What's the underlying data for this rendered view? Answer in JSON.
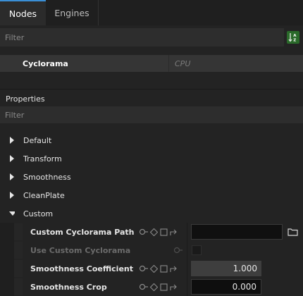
{
  "tabs": [
    {
      "label": "Nodes",
      "active": true
    },
    {
      "label": "Engines",
      "active": false
    }
  ],
  "nodes_filter": {
    "placeholder": "Filter",
    "sort_icon": "sort-alpha-icon"
  },
  "node_list": [
    {
      "name": "Cyclorama",
      "device": "CPU"
    }
  ],
  "properties": {
    "title": "Properties",
    "filter_placeholder": "Filter",
    "categories": [
      {
        "label": "Default",
        "expanded": false
      },
      {
        "label": "Transform",
        "expanded": false
      },
      {
        "label": "Smoothness",
        "expanded": false
      },
      {
        "label": "CleanPlate",
        "expanded": false
      },
      {
        "label": "Custom",
        "expanded": true
      }
    ],
    "items": [
      {
        "label": "Custom Cyclorama Path",
        "type": "path",
        "value": "",
        "enabled": true
      },
      {
        "label": "Use Custom Cyclorama",
        "type": "checkbox",
        "value": false,
        "enabled": false
      },
      {
        "label": "Smoothness Coefficient",
        "type": "number",
        "value": "1.000",
        "enabled": true
      },
      {
        "label": "Smoothness Crop",
        "type": "number",
        "value": "0.000",
        "enabled": true
      }
    ]
  },
  "colors": {
    "accent": "#3a8fd6",
    "sort_button": "#2a6a2a",
    "background": "#232323"
  }
}
